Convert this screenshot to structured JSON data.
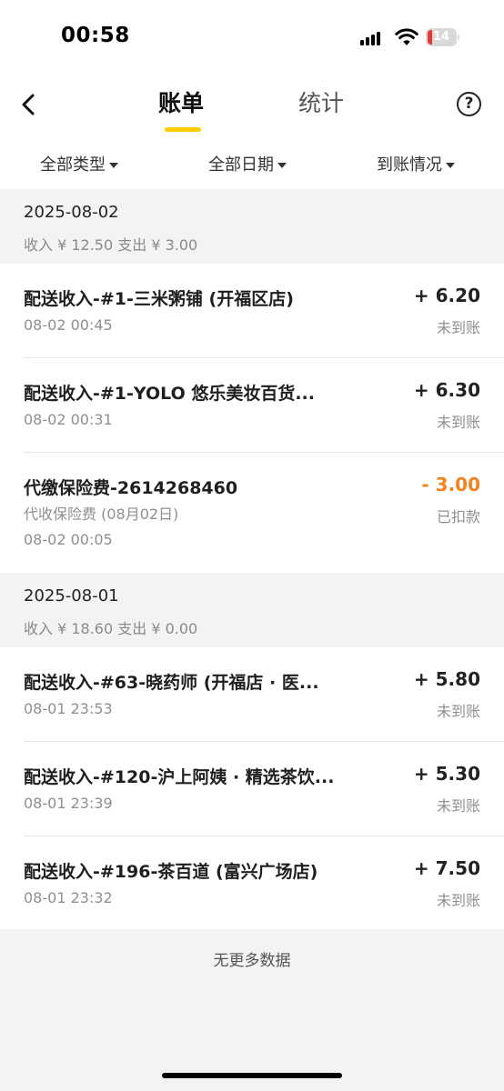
{
  "status_bar": {
    "time": "00:58",
    "battery": "14",
    "battery_color": "#e53935"
  },
  "nav": {
    "tabs": [
      {
        "label": "账单",
        "active": true
      },
      {
        "label": "统计",
        "active": false
      }
    ],
    "help_icon": "question-circle-icon",
    "accent_color": "#ffcc00"
  },
  "filters": [
    {
      "label": "全部类型"
    },
    {
      "label": "全部日期"
    },
    {
      "label": "到账情况"
    }
  ],
  "groups": [
    {
      "date": "2025-08-02",
      "summary": "收入 ¥ 12.50 支出 ¥ 3.00",
      "records": [
        {
          "title": "配送收入-#1-三米粥铺 (开福区店)",
          "time": "08-02 00:45",
          "amount": "+ 6.20",
          "status": "未到账"
        },
        {
          "title": "配送收入-#1-YOLO 悠乐美妆百货...",
          "time": "08-02 00:31",
          "amount": "+ 6.30",
          "status": "未到账"
        },
        {
          "title": "代缴保险费-2614268460",
          "note": "代收保险费 (08月02日)",
          "time": "08-02 00:05",
          "amount": "- 3.00",
          "status": "已扣款",
          "amount_color": "#f5821f"
        }
      ]
    },
    {
      "date": "2025-08-01",
      "summary": "收入 ¥ 18.60 支出 ¥ 0.00",
      "records": [
        {
          "title": "配送收入-#63-晓药师 (开福店 · 医...",
          "time": "08-01 23:53",
          "amount": "+ 5.80",
          "status": "未到账"
        },
        {
          "title": "配送收入-#120-沪上阿姨 · 精选茶饮...",
          "time": "08-01 23:39",
          "amount": "+ 5.30",
          "status": "未到账"
        },
        {
          "title": "配送收入-#196-茶百道 (富兴广场店)",
          "time": "08-01 23:32",
          "amount": "+ 7.50",
          "status": "未到账"
        }
      ]
    }
  ],
  "footer": {
    "no_more": "无更多数据"
  }
}
